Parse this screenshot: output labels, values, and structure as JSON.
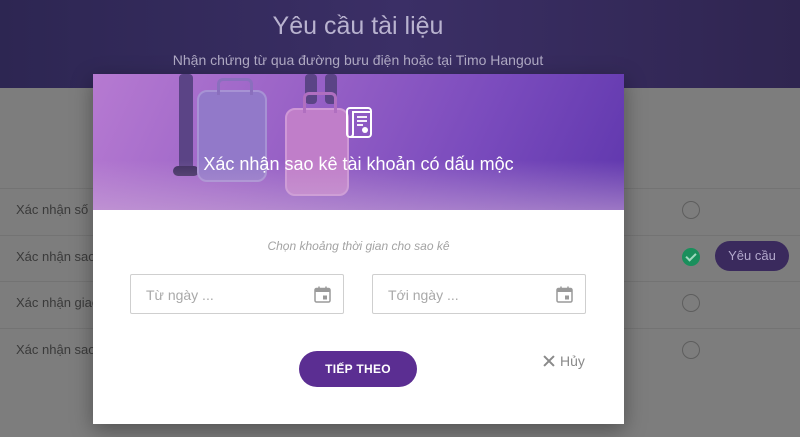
{
  "background_page": {
    "title": "Yêu cầu tài liệu",
    "subtitle": "Nhận chứng từ qua đường bưu điện hoặc tại Timo Hangout",
    "rows": [
      {
        "label": "Xác nhận số",
        "selected": false
      },
      {
        "label": "Xác nhận sao",
        "selected": true,
        "action_label": "Yêu cầu"
      },
      {
        "label": "Xác nhận giao",
        "selected": false
      },
      {
        "label": "Xác nhận sao",
        "selected": false
      }
    ]
  },
  "modal": {
    "icon": "document-certificate-icon",
    "title": "Xác nhận sao kê tài khoản có dấu mộc",
    "subtitle": "Chọn khoảng thời gian cho sao kê",
    "from_date": {
      "placeholder": "Từ ngày ...",
      "icon": "calendar-icon"
    },
    "to_date": {
      "placeholder": "Tới ngày ...",
      "icon": "calendar-icon"
    },
    "next_label": "TIẾP THEO",
    "cancel_label": "Hủy"
  },
  "colors": {
    "accent": "#5b2e92",
    "hero_gradient_start": "#b67ad1",
    "hero_gradient_end": "#5f37ad",
    "success": "#1a8f5c"
  }
}
